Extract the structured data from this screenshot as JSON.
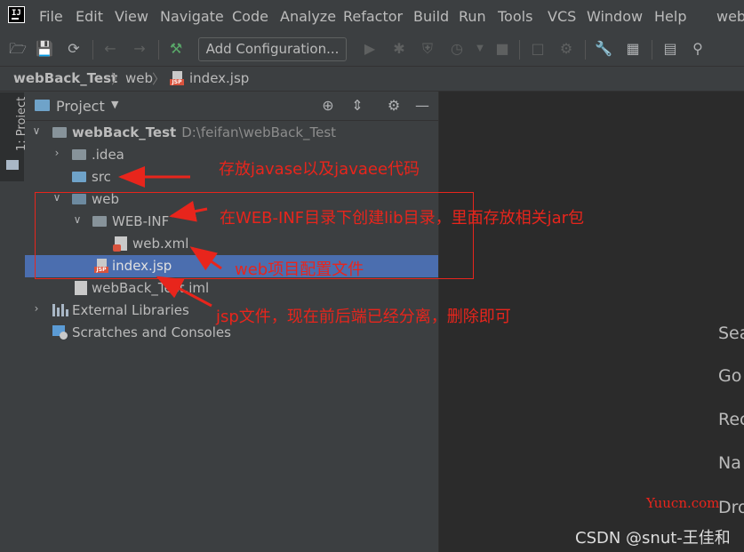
{
  "menubar": {
    "items": [
      "File",
      "Edit",
      "View",
      "Navigate",
      "Code",
      "Analyze",
      "Refactor",
      "Build",
      "Run",
      "Tools",
      "VCS",
      "Window",
      "Help"
    ],
    "trailing": "web"
  },
  "toolbar": {
    "config_label": "Add Configuration...",
    "icons": [
      "open-icon",
      "save-icon",
      "sync-icon",
      "back-icon",
      "forward-icon",
      "build-hammer-icon",
      "run-icon",
      "debug-icon",
      "coverage-icon",
      "profile-icon",
      "stop-icon",
      "attach-icon",
      "vcs-icon",
      "settings-icon",
      "project-structure-icon",
      "terminal-icon",
      "search-icon"
    ]
  },
  "breadcrumbs": {
    "project": "webBack_Test",
    "folder": "web",
    "file": "index.jsp"
  },
  "sidebar": {
    "tab_label": "1: Project"
  },
  "panel": {
    "title": "Project",
    "tree": [
      {
        "label": "webBack_Test",
        "path": "D:\\feifan\\webBack_Test"
      },
      {
        "label": ".idea"
      },
      {
        "label": "src"
      },
      {
        "label": "web"
      },
      {
        "label": "WEB-INF"
      },
      {
        "label": "web.xml"
      },
      {
        "label": "index.jsp"
      },
      {
        "label": "webBack_Test.iml"
      },
      {
        "label": "External Libraries"
      },
      {
        "label": "Scratches and Consoles"
      }
    ]
  },
  "editor": {
    "tips": [
      "Sea",
      "Go",
      "Rec",
      "Na",
      "Dro"
    ]
  },
  "annotations": {
    "src_note": "存放javase以及javaee代码",
    "webinf_note": "在WEB-INF目录下创建lib目录，里面存放相关jar包",
    "webxml_note": "web项目配置文件",
    "jsp_note": "jsp文件，现在前后端已经分离，删除即可"
  },
  "watermark": "Yuucn.com",
  "credit": "CSDN @snut-王佳和",
  "colors": {
    "background": "#2b2b2b",
    "panel": "#3c3f41",
    "selection": "#4b6eaf",
    "annotation": "#e8251c"
  }
}
